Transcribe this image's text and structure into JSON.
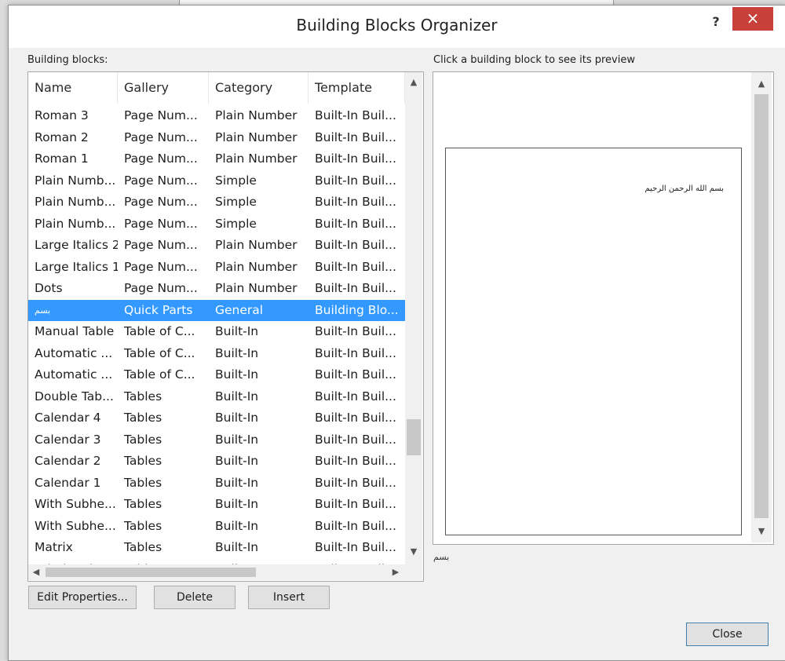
{
  "dialog": {
    "title": "Building Blocks Organizer",
    "help_label": "?",
    "close_label": "×"
  },
  "building_blocks_label": "Building blocks:",
  "preview_label": "Click a building block to see its preview",
  "columns": [
    "Name",
    "Gallery",
    "Category",
    "Template"
  ],
  "rows": [
    {
      "name": "Roman 3",
      "gallery": "Page Num...",
      "category": "Plain Number",
      "template": "Built-In Buil..."
    },
    {
      "name": "Roman 2",
      "gallery": "Page Num...",
      "category": "Plain Number",
      "template": "Built-In Buil..."
    },
    {
      "name": "Roman 1",
      "gallery": "Page Num...",
      "category": "Plain Number",
      "template": "Built-In Buil..."
    },
    {
      "name": "Plain Numb...",
      "gallery": "Page Num...",
      "category": "Simple",
      "template": "Built-In Buil..."
    },
    {
      "name": "Plain Numb...",
      "gallery": "Page Num...",
      "category": "Simple",
      "template": "Built-In Buil..."
    },
    {
      "name": "Plain Numb...",
      "gallery": "Page Num...",
      "category": "Simple",
      "template": "Built-In Buil..."
    },
    {
      "name": "Large Italics 2",
      "gallery": "Page Num...",
      "category": "Plain Number",
      "template": "Built-In Buil..."
    },
    {
      "name": "Large Italics 1",
      "gallery": "Page Num...",
      "category": "Plain Number",
      "template": "Built-In Buil..."
    },
    {
      "name": "Dots",
      "gallery": "Page Num...",
      "category": "Plain Number",
      "template": "Built-In Buil..."
    },
    {
      "name": "بسم",
      "gallery": "Quick Parts",
      "category": "General",
      "template": "Building Blo..."
    },
    {
      "name": "Manual Table",
      "gallery": "Table of C...",
      "category": "Built-In",
      "template": "Built-In Buil..."
    },
    {
      "name": "Automatic ...",
      "gallery": "Table of C...",
      "category": "Built-In",
      "template": "Built-In Buil..."
    },
    {
      "name": "Automatic ...",
      "gallery": "Table of C...",
      "category": "Built-In",
      "template": "Built-In Buil..."
    },
    {
      "name": "Double Tab...",
      "gallery": "Tables",
      "category": "Built-In",
      "template": "Built-In Buil..."
    },
    {
      "name": "Calendar 4",
      "gallery": "Tables",
      "category": "Built-In",
      "template": "Built-In Buil..."
    },
    {
      "name": "Calendar 3",
      "gallery": "Tables",
      "category": "Built-In",
      "template": "Built-In Buil..."
    },
    {
      "name": "Calendar 2",
      "gallery": "Tables",
      "category": "Built-In",
      "template": "Built-In Buil..."
    },
    {
      "name": "Calendar 1",
      "gallery": "Tables",
      "category": "Built-In",
      "template": "Built-In Buil..."
    },
    {
      "name": "With Subhe...",
      "gallery": "Tables",
      "category": "Built-In",
      "template": "Built-In Buil..."
    },
    {
      "name": "With Subhe...",
      "gallery": "Tables",
      "category": "Built-In",
      "template": "Built-In Buil..."
    },
    {
      "name": "Matrix",
      "gallery": "Tables",
      "category": "Built-In",
      "template": "Built-In Buil..."
    },
    {
      "name": "Tabular List",
      "gallery": "Tables",
      "category": "Built-In",
      "template": "Built-In Buil..."
    }
  ],
  "selected_index": 9,
  "preview": {
    "page_text": "بسم الله الرحمن الرحيم",
    "name": "بسم"
  },
  "buttons": {
    "edit": "Edit Properties...",
    "delete": "Delete",
    "insert": "Insert",
    "close": "Close"
  },
  "colors": {
    "selection": "#3399ff",
    "close_button": "#c7413a"
  }
}
